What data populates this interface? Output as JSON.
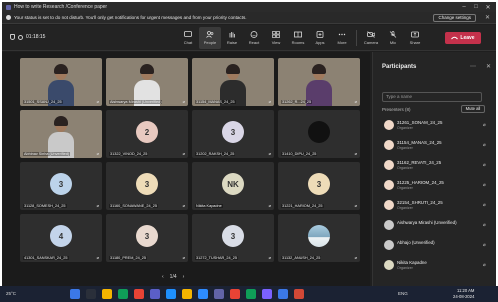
{
  "window": {
    "title": "How to write Research /Conference paper"
  },
  "notice": {
    "text": "Your status is set to do not disturb. You'll only get notifications for urgent messages and from your priority contacts.",
    "button_label": "Change settings"
  },
  "toolbar": {
    "timer": "01:18:15",
    "tools": [
      {
        "label": "Chat",
        "icon": "chat-icon",
        "active": false
      },
      {
        "label": "People",
        "icon": "people-icon",
        "active": true
      },
      {
        "label": "Raise",
        "icon": "raise-hand-icon",
        "active": false
      },
      {
        "label": "React",
        "icon": "react-icon",
        "active": false
      },
      {
        "label": "View",
        "icon": "view-icon",
        "active": false
      },
      {
        "label": "Rooms",
        "icon": "rooms-icon",
        "active": false
      },
      {
        "label": "Apps",
        "icon": "apps-icon",
        "active": false
      },
      {
        "label": "More",
        "icon": "more-icon",
        "active": false
      },
      {
        "label": "Camera",
        "icon": "camera-icon",
        "active": false
      },
      {
        "label": "Mic",
        "icon": "mic-icon",
        "active": false
      },
      {
        "label": "Share",
        "icon": "share-icon",
        "active": false
      }
    ],
    "leave_label": "Leave"
  },
  "tiles": [
    {
      "name": "31501_SSANJ_24_25",
      "type": "video"
    },
    {
      "name": "Aishwarya Mirashi (Unverified)",
      "type": "video"
    },
    {
      "name": "31154_MANAS_24_25",
      "type": "video"
    },
    {
      "name": "31262_R...24_25",
      "type": "video"
    },
    {
      "name": "Abhinav Sinha (Unverified)",
      "type": "video"
    },
    {
      "name": "31322_VINOD_24_25",
      "type": "avatar",
      "initials": "2",
      "color": "#e8c9c0"
    },
    {
      "name": "31202_RAKSH_24_25",
      "type": "avatar",
      "initials": "3",
      "color": "#d9d6e6"
    },
    {
      "name": "31410_DIPU_24_25",
      "type": "avatar",
      "initials": "",
      "color": "#111111"
    },
    {
      "name": "31128_SOMESH_24_25",
      "type": "avatar",
      "initials": "3",
      "color": "#bcd3ea"
    },
    {
      "name": "31160_SONAWANE_24_25",
      "type": "avatar",
      "initials": "3",
      "color": "#eedcb8"
    },
    {
      "name": "Nikita Kapadne",
      "type": "avatar",
      "initials": "NK",
      "color": "#dcd9c2"
    },
    {
      "name": "31221_HARIOM_24_25",
      "type": "avatar",
      "initials": "3",
      "color": "#eedcb8"
    },
    {
      "name": "41301_SANSKAR_24_25",
      "type": "avatar",
      "initials": "4",
      "color": "#c3d4ea"
    },
    {
      "name": "31180_PREM_24_25",
      "type": "avatar",
      "initials": "3",
      "color": "#e9d9cf"
    },
    {
      "name": "31272_TUSHAR_24_25",
      "type": "avatar",
      "initials": "3",
      "color": "#d9dde6"
    },
    {
      "name": "31132_ANUSH_24_25",
      "type": "photo",
      "initials": "",
      "color": "#8fb6c9"
    }
  ],
  "pager": {
    "text": "1/4"
  },
  "participants": {
    "title": "Participants",
    "search_placeholder": "Type a name",
    "section": "Presenters (8)",
    "mute_all": "Mute all",
    "list": [
      {
        "name": "31261_SONAM_24_25",
        "role": "Organizer",
        "color": "#f0d8c8"
      },
      {
        "name": "31154_MANAS_24_25",
        "role": "Organizer",
        "color": "#f0d8c8"
      },
      {
        "name": "31162_REVATI_24_25",
        "role": "Organizer",
        "color": "#f0d8c8"
      },
      {
        "name": "31225_HARIOM_24_25",
        "role": "Organizer",
        "color": "#f0d8c8"
      },
      {
        "name": "32154_SHRUTI_24_25",
        "role": "Organizer",
        "color": "#f0d8c8"
      },
      {
        "name": "Aishwarya Mirashi (Unverified)",
        "role": "",
        "color": "#c9c9c9"
      },
      {
        "name": "Abhajo (Unverified)",
        "role": "",
        "color": "#c9c9c9"
      },
      {
        "name": "Nikita Kapadne",
        "role": "Organizer",
        "color": "#dcd9c2"
      }
    ]
  },
  "taskbar": {
    "weather": "25°C",
    "sys": "ENG",
    "time": "11:20 AM",
    "date": "24-08-2024"
  }
}
